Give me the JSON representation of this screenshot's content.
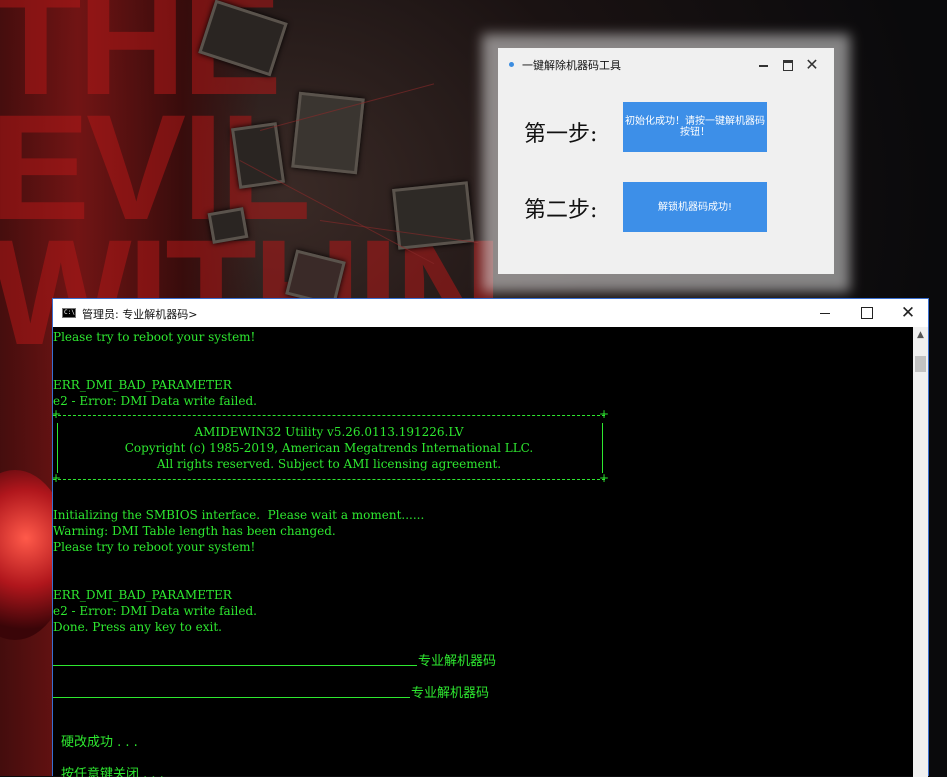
{
  "dialog": {
    "title": "一键解除机器码工具",
    "step1_label": "第一步:",
    "step1_button": "初始化成功！请按一键解机器码按钮！",
    "step2_label": "第二步:",
    "step2_button": "解锁机器码成功!"
  },
  "console": {
    "title": "管理员: 专业解机器码>",
    "icon_text": "C:\\",
    "lines": {
      "l1": "Please try to reboot your system!",
      "l2": "ERR_DMI_BAD_PARAMETER",
      "l3": "e2 - Error: DMI Data write failed.",
      "l4": "Initializing the SMBIOS interface.  Please wait a moment......",
      "l5": "Warning: DMI Table length has been changed.",
      "l6": "Please try to reboot your system!",
      "l7": "ERR_DMI_BAD_PARAMETER",
      "l8": "e2 - Error: DMI Data write failed.",
      "l9": "Done. Press any key to exit."
    },
    "banner": {
      "line1": "AMIDEWIN32 Utility v5.26.0113.191226.LV",
      "line2": "Copyright (c) 1985-2019, American Megatrends International LLC.",
      "line3": "All rights reserved. Subject to AMI licensing agreement."
    },
    "separator_label_1": "专业解机器码",
    "separator_label_2": "专业解机器码",
    "status_success": "硬改成功 . . .",
    "status_exit": "按任意键关闭 . . ."
  }
}
